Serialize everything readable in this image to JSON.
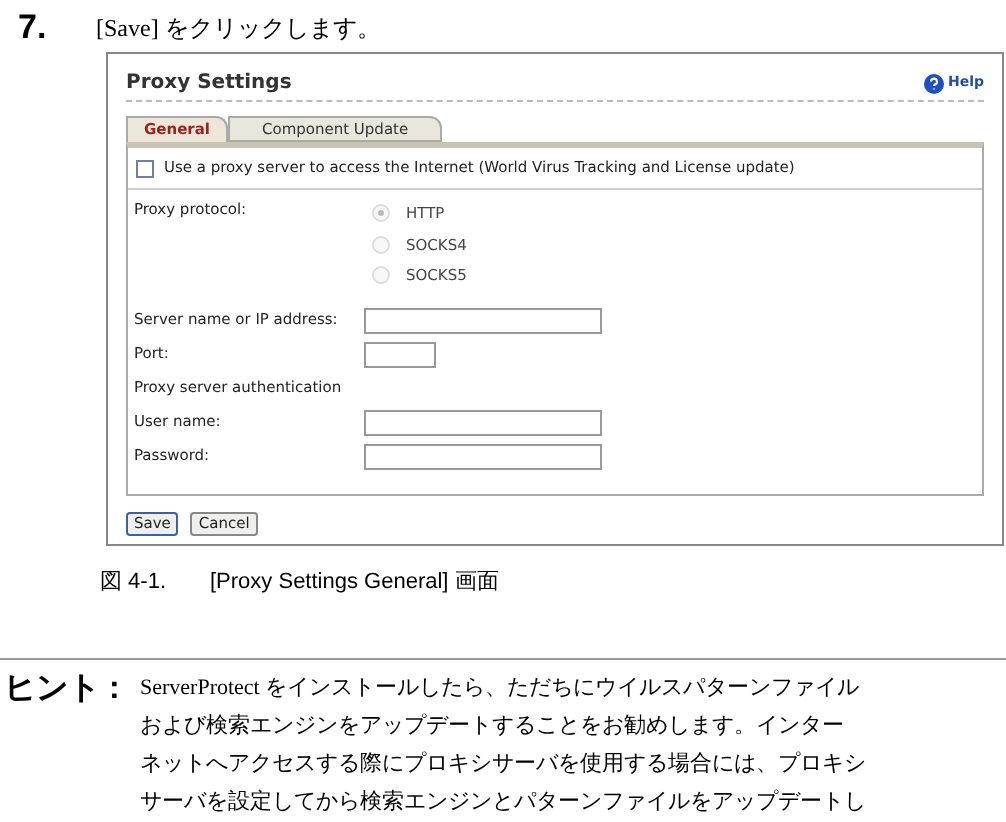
{
  "step": {
    "number": "7.",
    "text": "[Save] をクリックします。"
  },
  "screen": {
    "title": "Proxy Settings",
    "help": "Help",
    "tabs": [
      {
        "label": "General",
        "selected": true
      },
      {
        "label": "Component Update",
        "selected": false
      }
    ],
    "use_proxy": {
      "label": "Use a proxy server to access the Internet (World Virus Tracking and License update)",
      "checked": false
    },
    "protocol": {
      "label": "Proxy protocol:",
      "disabled": true,
      "options": [
        {
          "label": "HTTP",
          "selected": true
        },
        {
          "label": "SOCKS4",
          "selected": false
        },
        {
          "label": "SOCKS5",
          "selected": false
        }
      ]
    },
    "rows": [
      {
        "kind": "field",
        "label": "Server name or IP address:"
      },
      {
        "kind": "short_field",
        "label": "Port:"
      },
      {
        "kind": "heading",
        "label": "Proxy server authentication"
      },
      {
        "kind": "field",
        "label": "User name:"
      },
      {
        "kind": "field",
        "label": "Password:"
      }
    ],
    "buttons": [
      {
        "label": "Save",
        "default": true
      },
      {
        "label": "Cancel",
        "default": false
      }
    ]
  },
  "caption": {
    "number": "図 4-1.",
    "text": "[Proxy Settings General] 画面"
  },
  "hint": {
    "label": "ヒント :",
    "lines": [
      "ServerProtect をインストールしたら、ただちにウイルスパターンファイル",
      "および検索エンジンをアップデートすることをお勧めします。インター",
      "ネットへアクセスする際にプロキシサーバを使用する場合には、プロキシ",
      "サーバを設定してから検索エンジンとパターンファイルをアップデートし"
    ]
  }
}
